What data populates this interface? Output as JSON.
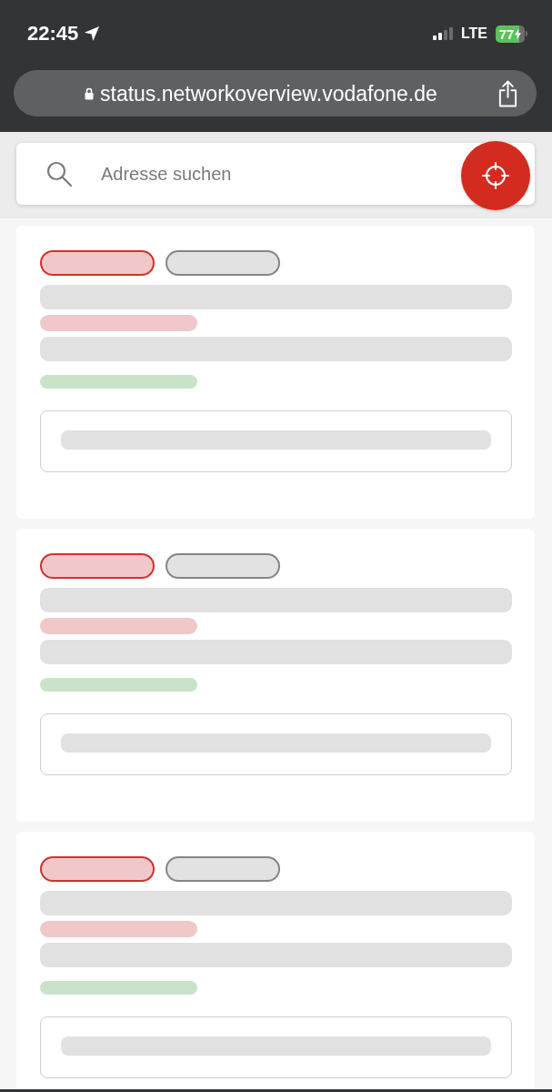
{
  "status_bar": {
    "time": "22:45",
    "network": "LTE",
    "battery": "77",
    "charging": true
  },
  "browser": {
    "url": "status.networkoverview.vodafone.de",
    "secure": true
  },
  "search": {
    "placeholder": "Adresse suchen"
  },
  "results": [
    {
      "kind": "skeleton"
    },
    {
      "kind": "skeleton"
    },
    {
      "kind": "skeleton"
    }
  ]
}
